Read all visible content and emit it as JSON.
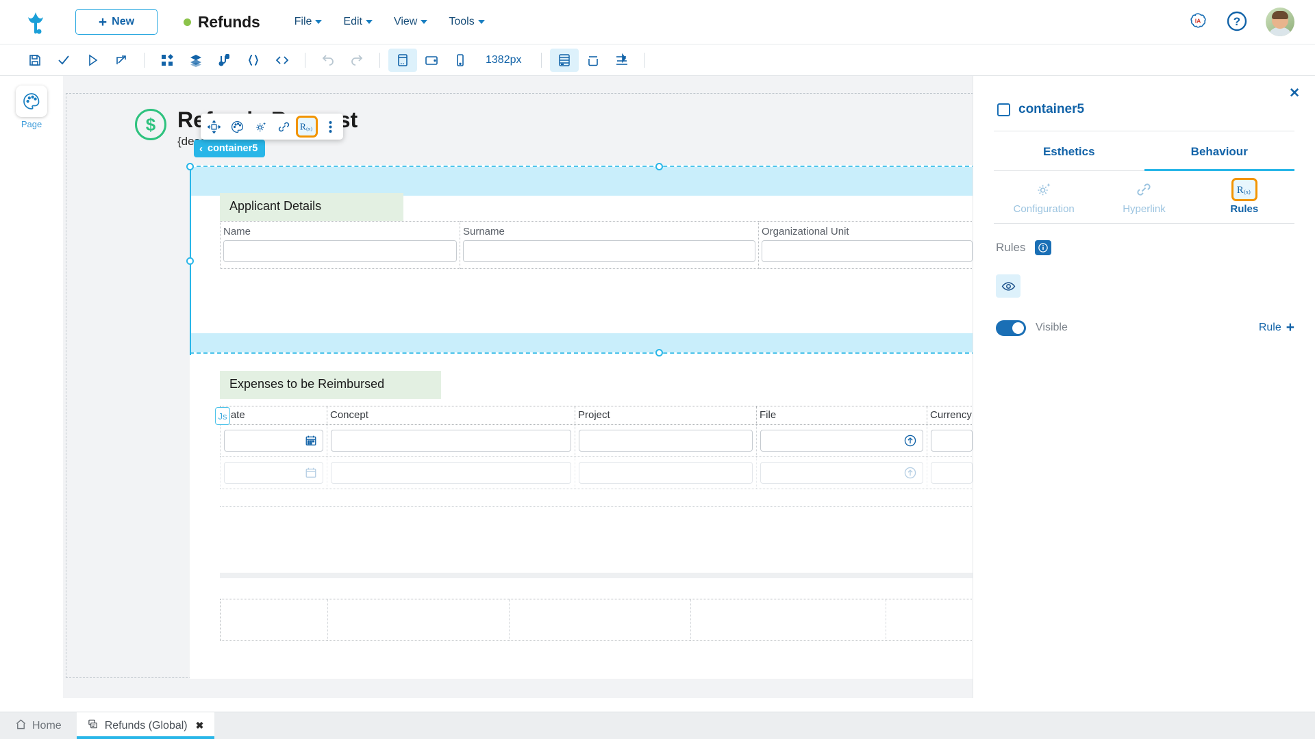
{
  "header": {
    "logo_icon": "app-logo-icon",
    "new_button": "New",
    "document_title": "Refunds",
    "status_dot_color": "#8bc34a",
    "menus": [
      "File",
      "Edit",
      "View",
      "Tools"
    ],
    "ia_badge": "IA",
    "help_icon": "help-question-icon",
    "avatar": "user-avatar"
  },
  "toolbar": {
    "zoom_value": "1382px",
    "groups": [
      {
        "items": [
          {
            "name": "save-icon",
            "state": "enabled"
          },
          {
            "name": "validate-check-icon",
            "state": "enabled"
          },
          {
            "name": "run-play-icon",
            "state": "enabled"
          },
          {
            "name": "publish-export-icon",
            "state": "enabled"
          }
        ]
      },
      {
        "items": [
          {
            "name": "widgets-grid-icon",
            "state": "enabled"
          },
          {
            "name": "layers-stack-icon",
            "state": "enabled"
          },
          {
            "name": "connections-icon",
            "state": "enabled"
          },
          {
            "name": "braces-json-icon",
            "state": "enabled"
          },
          {
            "name": "code-icon",
            "state": "enabled"
          }
        ]
      },
      {
        "items": [
          {
            "name": "undo-icon",
            "state": "disabled"
          },
          {
            "name": "redo-icon",
            "state": "disabled"
          }
        ]
      },
      {
        "items": [
          {
            "name": "desktop-view-icon",
            "state": "active"
          },
          {
            "name": "tablet-view-icon",
            "state": "enabled"
          },
          {
            "name": "mobile-view-icon",
            "state": "enabled"
          }
        ]
      },
      {
        "items": [
          {
            "name": "form-layout-icon",
            "state": "enabled"
          },
          {
            "name": "container-icon",
            "state": "enabled"
          },
          {
            "name": "align-icon",
            "state": "enabled"
          }
        ]
      }
    ]
  },
  "left_rail": {
    "items": [
      {
        "icon": "palette-page-icon",
        "label": "Page"
      }
    ]
  },
  "canvas": {
    "document": {
      "icon": "dollar-circle-icon",
      "heading": "Refunds Request",
      "subheading": "{description}"
    },
    "selection": {
      "tag_label": "container5",
      "back_arrow": "‹",
      "float_toolbar": [
        {
          "name": "move-arrows-icon",
          "highlighted": false
        },
        {
          "name": "palette-style-icon",
          "highlighted": false
        },
        {
          "name": "gear-configuration-icon",
          "highlighted": false
        },
        {
          "name": "hyperlink-icon",
          "highlighted": false
        },
        {
          "name": "rules-rx-icon",
          "highlighted": true
        },
        {
          "name": "more-vertical-icon",
          "highlighted": false
        }
      ]
    },
    "applicant_section": {
      "title": "Applicant Details",
      "fields": [
        {
          "label": "Name",
          "value": ""
        },
        {
          "label": "Surname",
          "value": ""
        },
        {
          "label": "Organizational Unit",
          "value": ""
        }
      ]
    },
    "expenses_section": {
      "title": "Expenses to be Reimbursed",
      "js_badge": "Js",
      "columns": [
        "Date",
        "Concept",
        "Project",
        "File",
        "Currency"
      ],
      "rows": [
        {
          "date": "",
          "concept": "",
          "project": "",
          "file": "",
          "currency": "",
          "faded": false
        },
        {
          "date": "",
          "concept": "",
          "project": "",
          "file": "",
          "currency": "",
          "faded": true
        }
      ],
      "date_icon": "calendar-icon",
      "upload_icon": "upload-circle-icon"
    },
    "scrollbar": {
      "left_arrow": "◀",
      "right_arrow": "▶"
    }
  },
  "right_panel": {
    "close_icon": "close-icon",
    "element_name": "container5",
    "tabs": [
      {
        "label": "Esthetics",
        "active": false
      },
      {
        "label": "Behaviour",
        "active": true
      }
    ],
    "subtabs": [
      {
        "label": "Configuration",
        "icon": "gear-configuration-icon",
        "active": false
      },
      {
        "label": "Hyperlink",
        "icon": "hyperlink-icon",
        "active": false
      },
      {
        "label": "Rules",
        "icon": "rules-rx-icon",
        "active": true
      }
    ],
    "section_label": "Rules",
    "info_icon": "info-icon",
    "eye_icon": "eye-visibility-icon",
    "toggle": {
      "label": "Visible",
      "on": true
    },
    "add_rule": {
      "label": "Rule",
      "plus": "+"
    }
  },
  "bottom_bar": {
    "home": {
      "label": "Home",
      "icon": "home-icon"
    },
    "tabs": [
      {
        "label": "Refunds (Global)",
        "icon": "form-file-icon",
        "close": "✖",
        "active": true
      }
    ]
  },
  "colors": {
    "primary_blue": "#1263a8",
    "accent_cyan": "#29b6e8",
    "highlight_orange": "#f29400",
    "selection_fill": "#c9eefb",
    "section_green": "#e3f0e2",
    "status_green": "#8bc34a"
  }
}
